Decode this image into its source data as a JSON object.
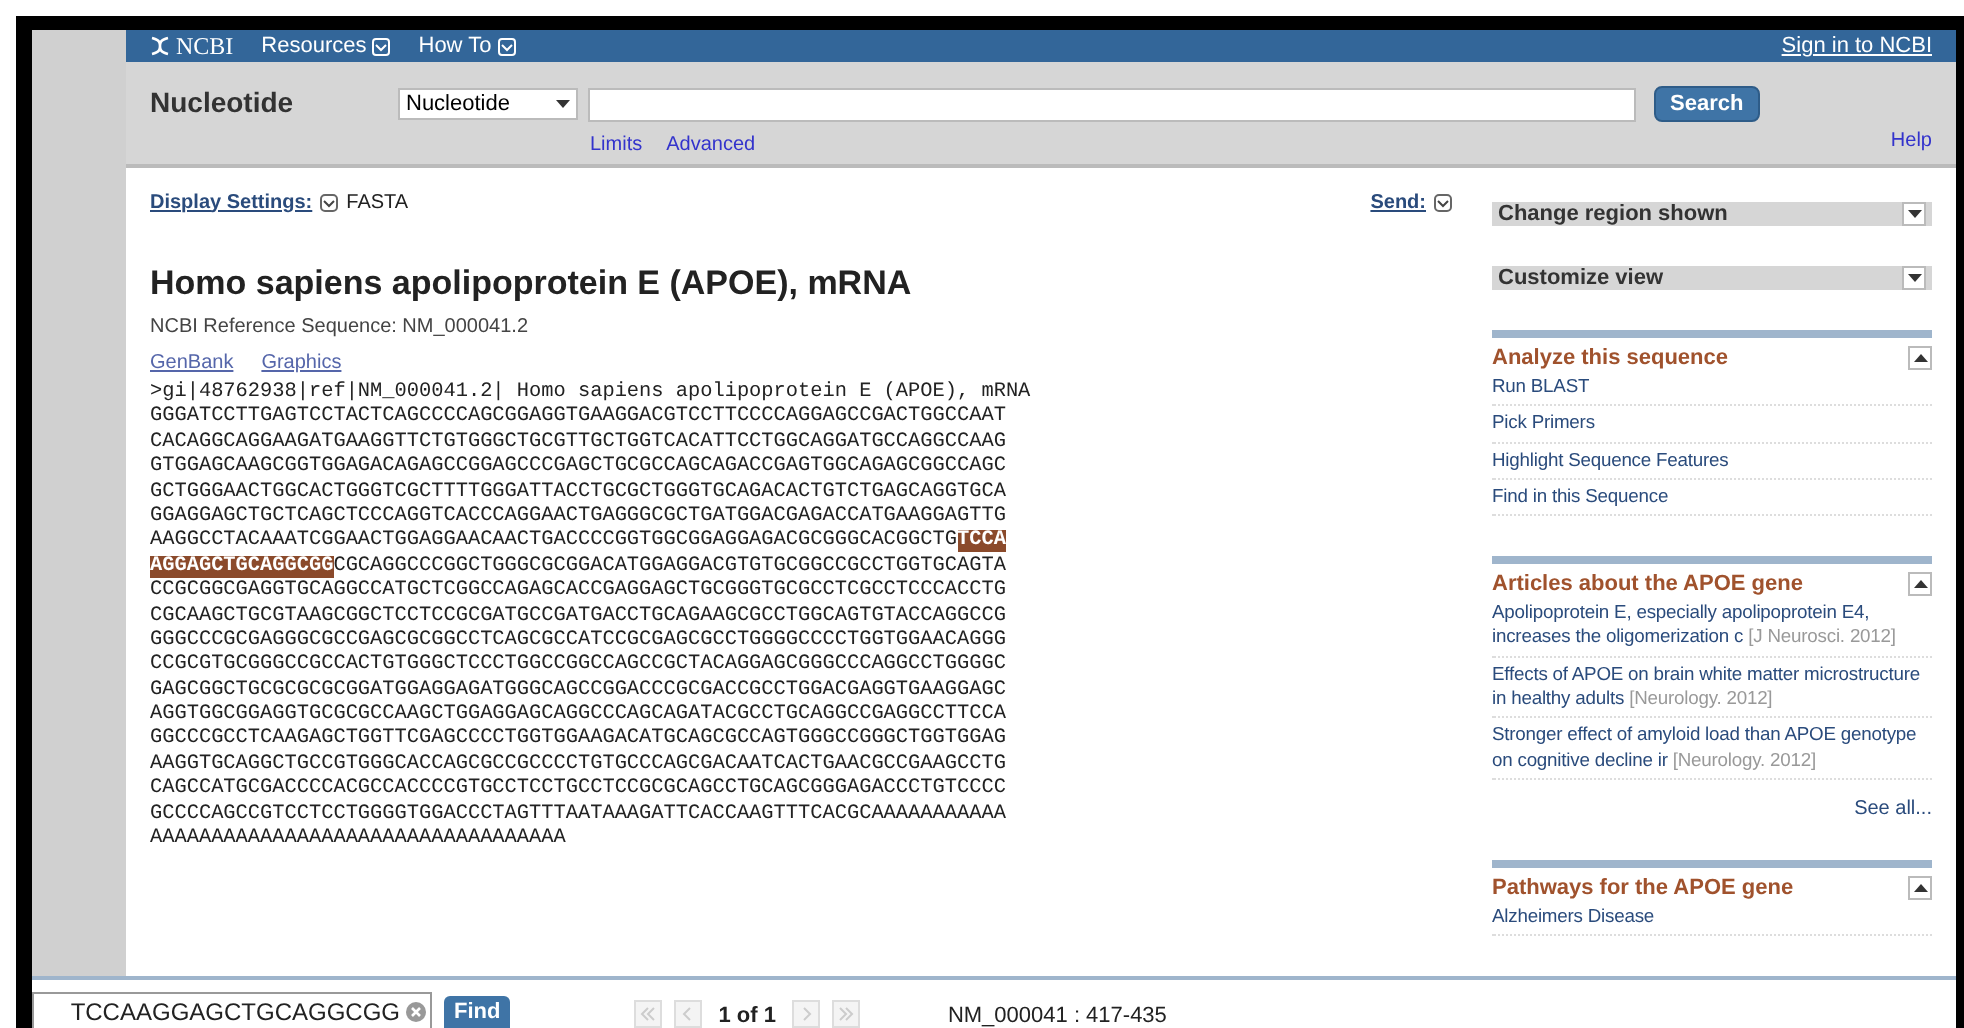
{
  "header": {
    "logo": "NCBI",
    "menus": [
      "Resources",
      "How To"
    ],
    "sign_in": "Sign in to NCBI"
  },
  "search": {
    "database_label": "Nucleotide",
    "database": "Nucleotide",
    "button": "Search",
    "links": [
      "Limits",
      "Advanced"
    ],
    "help": "Help"
  },
  "display": {
    "settings_label": "Display Settings:",
    "format": "FASTA",
    "send": "Send:"
  },
  "record": {
    "title": "Homo sapiens apolipoprotein E (APOE), mRNA",
    "reference": "NCBI Reference Sequence: NM_000041.2",
    "views": [
      "GenBank",
      "Graphics"
    ],
    "sequence": [
      [
        {
          "text": ">gi|48762938|ref|NM_000041.2| Homo sapiens apolipoprotein E (APOE), mRNA",
          "highlighted": false
        }
      ],
      [
        {
          "text": "GGGATCCTTGAGTCCTACTCAGCCCCAGCGGAGGTGAAGGACGTCCTTCCCCAGGAGCCGACTGGCCAAT",
          "highlighted": false
        }
      ],
      [
        {
          "text": "CACAGGCAGGAAGATGAAGGTTCTGTGGGCTGCGTTGCTGGTCACATTCCTGGCAGGATGCCAGGCCAAG",
          "highlighted": false
        }
      ],
      [
        {
          "text": "GTGGAGCAAGCGGTGGAGACAGAGCCGGAGCCCGAGCTGCGCCAGCAGACCGAGTGGCAGAGCGGCCAGC",
          "highlighted": false
        }
      ],
      [
        {
          "text": "GCTGGGAACTGGCACTGGGTCGCTTTTGGGATTACCTGCGCTGGGTGCAGACACTGTCTGAGCAGGTGCA",
          "highlighted": false
        }
      ],
      [
        {
          "text": "GGAGGAGCTGCTCAGCTCCCAGGTCACCCAGGAACTGAGGGCGCTGATGGACGAGACCATGAAGGAGTTG",
          "highlighted": false
        }
      ],
      [
        {
          "text": "AAGGCCTACAAATCGGAACTGGAGGAACAACTGACCCCGGTGGCGGAGGAGACGCGGGCACGGCTG",
          "highlighted": false
        },
        {
          "text": "TCCA",
          "highlighted": true
        }
      ],
      [
        {
          "text": "AGGAGCTGCAGGCGG",
          "highlighted": true
        },
        {
          "text": "CGCAGGCCCGGCTGGGCGCGGACATGGAGGACGTGTGCGGCCGCCTGGTGCAGTA",
          "highlighted": false
        }
      ],
      [
        {
          "text": "CCGCGGCGAGGTGCAGGCCATGCTCGGCCAGAGCACCGAGGAGCTGCGGGTGCGCCTCGCCTCCCACCTG",
          "highlighted": false
        }
      ],
      [
        {
          "text": "CGCAAGCTGCGTAAGCGGCTCCTCCGCGATGCCGATGACCTGCAGAAGCGCCTGGCAGTGTACCAGGCCG",
          "highlighted": false
        }
      ],
      [
        {
          "text": "GGGCCCGCGAGGGCGCCGAGCGCGGCCTCAGCGCCATCCGCGAGCGCCTGGGGCCCCTGGTGGAACAGGG",
          "highlighted": false
        }
      ],
      [
        {
          "text": "CCGCGTGCGGGCCGCCACTGTGGGCTCCCTGGCCGGCCAGCCGCTACAGGAGCGGGCCCAGGCCTGGGGC",
          "highlighted": false
        }
      ],
      [
        {
          "text": "GAGCGGCTGCGCGCGCGGATGGAGGAGATGGGCAGCCGGACCCGCGACCGCCTGGACGAGGTGAAGGAGC",
          "highlighted": false
        }
      ],
      [
        {
          "text": "AGGTGGCGGAGGTGCGCGCCAAGCTGGAGGAGCAGGCCCAGCAGATACGCCTGCAGGCCGAGGCCTTCCA",
          "highlighted": false
        }
      ],
      [
        {
          "text": "GGCCCGCCTCAAGAGCTGGTTCGAGCCCCTGGTGGAAGACATGCAGCGCCAGTGGGCCGGGCTGGTGGAG",
          "highlighted": false
        }
      ],
      [
        {
          "text": "AAGGTGCAGGCTGCCGTGGGCACCAGCGCCGCCCCTGTGCCCAGCGACAATCACTGAACGCCGAAGCCTG",
          "highlighted": false
        }
      ],
      [
        {
          "text": "CAGCCATGCGACCCCACGCCACCCCGTGCCTCCTGCCTCCGCGCAGCCTGCAGCGGGAGACCCTGTCCCC",
          "highlighted": false
        }
      ],
      [
        {
          "text": "GCCCCAGCCGTCCTCCTGGGGTGGACCCTAGTTTAATAAAGATTCACCAAGTTTCACGCAAAAAAAAAAA",
          "highlighted": false
        }
      ],
      [
        {
          "text": "AAAAAAAAAAAAAAAAAAAAAAAAAAAAAAAAAA",
          "highlighted": false
        }
      ]
    ]
  },
  "sidebar": {
    "dropdowns": [
      "Change region shown",
      "Customize view"
    ],
    "sections": [
      {
        "title": "Analyze this sequence",
        "links": [
          {
            "text": "Run BLAST"
          },
          {
            "text": "Pick Primers"
          },
          {
            "text": "Highlight Sequence Features"
          },
          {
            "text": "Find in this Sequence"
          }
        ]
      },
      {
        "title": "Articles about the APOE gene",
        "links": [
          {
            "text": "Apolipoprotein E, especially apolipoprotein E4, increases the oligomerization c",
            "source": "[J Neurosci. 2012]"
          },
          {
            "text": "Effects of APOE on brain white matter microstructure in healthy adults",
            "source": "[Neurology. 2012]"
          },
          {
            "text": "Stronger effect of amyloid load than APOE genotype on cognitive decline ir",
            "source": "[Neurology. 2012]"
          }
        ],
        "more": "See all..."
      },
      {
        "title": "Pathways for the APOE gene",
        "links": [
          {
            "text": "Alzheimers Disease"
          }
        ]
      }
    ]
  },
  "find_bar": {
    "value": "TCCAAGGAGCTGCAGGCGG",
    "button": "Find",
    "nav": [
      {
        "kind": "first",
        "disabled": true
      },
      {
        "kind": "prev",
        "disabled": true
      },
      {
        "kind": "count",
        "text": "1 of 1"
      },
      {
        "kind": "next",
        "disabled": true
      },
      {
        "kind": "last",
        "disabled": true
      }
    ],
    "location": "NM_000041 : 417-435"
  }
}
